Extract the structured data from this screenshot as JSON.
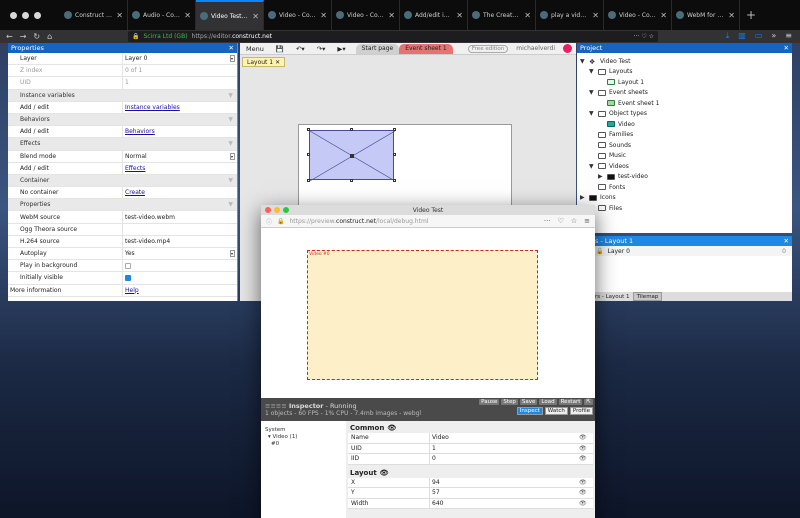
{
  "browser": {
    "tabs": [
      {
        "title": "Construct Offici"
      },
      {
        "title": "Audio - Constru"
      },
      {
        "title": "Video Test - Co",
        "active": true
      },
      {
        "title": "Video - Constru"
      },
      {
        "title": "Video - Constru"
      },
      {
        "title": "Add/edit instan"
      },
      {
        "title": "The Create New"
      },
      {
        "title": "play a video in o"
      },
      {
        "title": "Video - Constru"
      },
      {
        "title": "WebM for Premi"
      }
    ],
    "new_tab_symbol": "+",
    "url_secure_label": "Scirra Ltd (GB)",
    "url": "https://editor.construct.net",
    "url_host": "construct.net",
    "url_prefix": "https://editor."
  },
  "properties": {
    "title": "Properties",
    "rows": [
      {
        "key": "Layer",
        "value": "Layer 0",
        "kind": "dropdown"
      },
      {
        "key": "Z index",
        "value": "0 of 1",
        "kind": "disabled"
      },
      {
        "key": "UID",
        "value": "1",
        "kind": "disabled"
      },
      {
        "key": "Instance variables",
        "kind": "section"
      },
      {
        "key": "Add / edit",
        "value": "Instance variables",
        "kind": "link"
      },
      {
        "key": "Behaviors",
        "kind": "section"
      },
      {
        "key": "Add / edit",
        "value": "Behaviors",
        "kind": "link"
      },
      {
        "key": "Effects",
        "kind": "section"
      },
      {
        "key": "Blend mode",
        "value": "Normal",
        "kind": "dropdown"
      },
      {
        "key": "Add / edit",
        "value": "Effects",
        "kind": "link"
      },
      {
        "key": "Container",
        "kind": "section"
      },
      {
        "key": "No container",
        "value": "Create",
        "kind": "link"
      },
      {
        "key": "Properties",
        "kind": "section"
      },
      {
        "key": "WebM source",
        "value": "test-video.webm",
        "kind": "text"
      },
      {
        "key": "Ogg Theora source",
        "value": "",
        "kind": "text"
      },
      {
        "key": "H.264 source",
        "value": "test-video.mp4",
        "kind": "text"
      },
      {
        "key": "Autoplay",
        "value": "Yes",
        "kind": "dropdown"
      },
      {
        "key": "Play in background",
        "value": "",
        "kind": "checkbox-off"
      },
      {
        "key": "Initially visible",
        "value": "",
        "kind": "checkbox-on"
      },
      {
        "key": "More information",
        "value": "Help",
        "kind": "link-root"
      }
    ]
  },
  "editor": {
    "menu_label": "Menu",
    "start_page_tab": "Start page",
    "event_sheet_tab": "Event sheet 1",
    "free_edition_label": "Free edition",
    "username": "michaelverdi",
    "layout_tab": "Layout 1"
  },
  "project": {
    "title": "Project",
    "items": [
      {
        "label": "Video Test",
        "depth": 0,
        "expander": "▼",
        "icon": "root"
      },
      {
        "label": "Layouts",
        "depth": 1,
        "expander": "▼",
        "icon": "f"
      },
      {
        "label": "Layout 1",
        "depth": 2,
        "expander": "",
        "icon": "lay"
      },
      {
        "label": "Event sheets",
        "depth": 1,
        "expander": "▼",
        "icon": "f"
      },
      {
        "label": "Event sheet 1",
        "depth": 2,
        "expander": "",
        "icon": "ev"
      },
      {
        "label": "Object types",
        "depth": 1,
        "expander": "▼",
        "icon": "f"
      },
      {
        "label": "Video",
        "depth": 2,
        "expander": "",
        "icon": "vid"
      },
      {
        "label": "Families",
        "depth": 1,
        "expander": "",
        "icon": "f"
      },
      {
        "label": "Sounds",
        "depth": 1,
        "expander": "",
        "icon": "f"
      },
      {
        "label": "Music",
        "depth": 1,
        "expander": "",
        "icon": "f"
      },
      {
        "label": "Videos",
        "depth": 1,
        "expander": "▼",
        "icon": "f"
      },
      {
        "label": "test-video",
        "depth": 2,
        "expander": "▶",
        "icon": "fd"
      },
      {
        "label": "Fonts",
        "depth": 1,
        "expander": "",
        "icon": "f"
      },
      {
        "label": "Icons",
        "depth": 0,
        "expander": "▶",
        "icon": "fd"
      },
      {
        "label": "Files",
        "depth": 1,
        "expander": "",
        "icon": "f"
      }
    ]
  },
  "layers": {
    "title": "s - Layout 1",
    "rows": [
      {
        "name": "Layer 0",
        "number": "0"
      }
    ],
    "bottom_tabs": [
      "rs - Layout 1",
      "Tilemap"
    ]
  },
  "preview": {
    "window_title": "Video Test",
    "url_prefix": "https://preview.",
    "url_host": "construct.net",
    "url_path": "/local/debug.html",
    "video_label": "Video #0",
    "inspector_title": "Inspector",
    "inspector_state": "- Running",
    "inspector_stats": "1 objects - 60 FPS - 1% CPU - 7.4mb images - webgl",
    "inspector_buttons": [
      "Pause",
      "Step",
      "Save",
      "Load",
      "Restart"
    ],
    "inspector_tabs": [
      "Inspect",
      "Watch",
      "Profile"
    ],
    "tree": [
      "System",
      "▾ Video (1)",
      "#0"
    ],
    "common_title": "Common",
    "common_rows": [
      {
        "key": "Name",
        "value": "Video"
      },
      {
        "key": "UID",
        "value": "1"
      },
      {
        "key": "IID",
        "value": "0"
      }
    ],
    "layout_title": "Layout",
    "layout_rows": [
      {
        "key": "X",
        "value": "94"
      },
      {
        "key": "Y",
        "value": "57"
      },
      {
        "key": "Width",
        "value": "640"
      }
    ]
  }
}
